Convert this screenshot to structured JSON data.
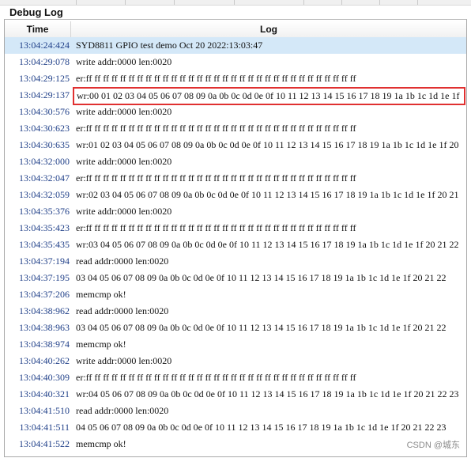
{
  "panel": {
    "title": "Debug Log"
  },
  "columns": {
    "time": "Time",
    "log": "Log"
  },
  "rows": [
    {
      "time": "13:04:24:424",
      "msg": "SYD8811 GPIO test demo Oct 20 2022:13:03:47"
    },
    {
      "time": "13:04:29:078",
      "msg": "write addr:0000 len:0020"
    },
    {
      "time": "13:04:29:125",
      "msg": "er:ff ff ff ff ff ff ff ff ff ff ff ff ff ff ff ff ff ff ff ff ff ff ff ff ff ff ff ff ff ff ff ff"
    },
    {
      "time": "13:04:29:137",
      "msg": "wr:00 01 02 03 04 05 06 07 08 09 0a 0b 0c 0d 0e 0f 10 11 12 13 14 15 16 17 18 19 1a 1b 1c 1d 1e 1f"
    },
    {
      "time": "13:04:30:576",
      "msg": "write addr:0000 len:0020"
    },
    {
      "time": "13:04:30:623",
      "msg": "er:ff ff ff ff ff ff ff ff ff ff ff ff ff ff ff ff ff ff ff ff ff ff ff ff ff ff ff ff ff ff ff ff"
    },
    {
      "time": "13:04:30:635",
      "msg": "wr:01 02 03 04 05 06 07 08 09 0a 0b 0c 0d 0e 0f 10 11 12 13 14 15 16 17 18 19 1a 1b 1c 1d 1e 1f 20"
    },
    {
      "time": "13:04:32:000",
      "msg": "write addr:0000 len:0020"
    },
    {
      "time": "13:04:32:047",
      "msg": "er:ff ff ff ff ff ff ff ff ff ff ff ff ff ff ff ff ff ff ff ff ff ff ff ff ff ff ff ff ff ff ff ff"
    },
    {
      "time": "13:04:32:059",
      "msg": "wr:02 03 04 05 06 07 08 09 0a 0b 0c 0d 0e 0f 10 11 12 13 14 15 16 17 18 19 1a 1b 1c 1d 1e 1f 20 21"
    },
    {
      "time": "13:04:35:376",
      "msg": "write addr:0000 len:0020"
    },
    {
      "time": "13:04:35:423",
      "msg": "er:ff ff ff ff ff ff ff ff ff ff ff ff ff ff ff ff ff ff ff ff ff ff ff ff ff ff ff ff ff ff ff ff"
    },
    {
      "time": "13:04:35:435",
      "msg": "wr:03 04 05 06 07 08 09 0a 0b 0c 0d 0e 0f 10 11 12 13 14 15 16 17 18 19 1a 1b 1c 1d 1e 1f 20 21 22"
    },
    {
      "time": "13:04:37:194",
      "msg": "read addr:0000 len:0020"
    },
    {
      "time": "13:04:37:195",
      "msg": "03 04 05 06 07 08 09 0a 0b 0c 0d 0e 0f 10 11 12 13 14 15 16 17 18 19 1a 1b 1c 1d 1e 1f 20 21 22"
    },
    {
      "time": "13:04:37:206",
      "msg": "memcmp ok!"
    },
    {
      "time": "13:04:38:962",
      "msg": "read addr:0000 len:0020"
    },
    {
      "time": "13:04:38:963",
      "msg": "03 04 05 06 07 08 09 0a 0b 0c 0d 0e 0f 10 11 12 13 14 15 16 17 18 19 1a 1b 1c 1d 1e 1f 20 21 22"
    },
    {
      "time": "13:04:38:974",
      "msg": "memcmp ok!"
    },
    {
      "time": "13:04:40:262",
      "msg": "write addr:0000 len:0020"
    },
    {
      "time": "13:04:40:309",
      "msg": "er:ff ff ff ff ff ff ff ff ff ff ff ff ff ff ff ff ff ff ff ff ff ff ff ff ff ff ff ff ff ff ff ff"
    },
    {
      "time": "13:04:40:321",
      "msg": "wr:04 05 06 07 08 09 0a 0b 0c 0d 0e 0f 10 11 12 13 14 15 16 17 18 19 1a 1b 1c 1d 1e 1f 20 21 22 23"
    },
    {
      "time": "13:04:41:510",
      "msg": "read addr:0000 len:0020"
    },
    {
      "time": "13:04:41:511",
      "msg": "04 05 06 07 08 09 0a 0b 0c 0d 0e 0f 10 11 12 13 14 15 16 17 18 19 1a 1b 1c 1d 1e 1f 20 21 22 23"
    },
    {
      "time": "13:04:41:522",
      "msg": "memcmp ok!"
    }
  ],
  "selected_row": 0,
  "highlighted_row": 3,
  "watermark": "CSDN @城东",
  "colors": {
    "time_text": "#1f3f88",
    "selected_row_bg": "#d4e8f8",
    "highlight_border": "#e03030"
  }
}
